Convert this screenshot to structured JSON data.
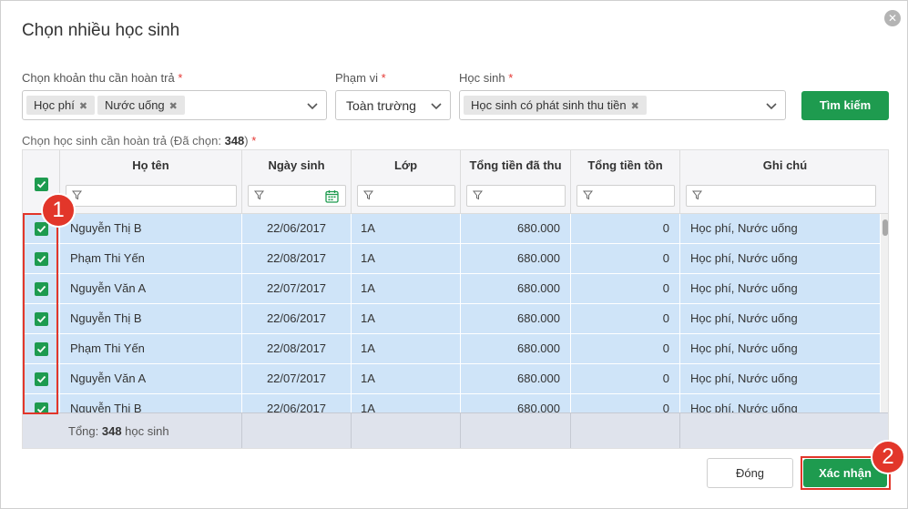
{
  "dialog": {
    "title": "Chọn nhiều học sinh",
    "close_icon": "close-icon"
  },
  "filters": {
    "fee_label": "Chọn khoản thu cần hoàn trả",
    "fee_tags": [
      "Học phí",
      "Nước uống"
    ],
    "scope_label": "Phạm vi",
    "scope_value": "Toàn trường",
    "student_label": "Học sinh",
    "student_tag": "Học sinh có phát sinh thu tiền",
    "required_mark": "*",
    "tag_remove": "✖",
    "search_button": "Tìm kiếm"
  },
  "grid": {
    "label_prefix": "Chọn học sinh cần hoàn trả (Đã chọn: ",
    "selected_count": "348",
    "label_suffix": ")",
    "columns": [
      "Họ tên",
      "Ngày sinh",
      "Lớp",
      "Tổng tiền đã thu",
      "Tổng tiền tồn",
      "Ghi chú"
    ],
    "rows": [
      {
        "name": "Nguyễn Thị B",
        "dob": "22/06/2017",
        "class": "1A",
        "paid": "680.000",
        "balance": "0",
        "note": "Học phí, Nước uống"
      },
      {
        "name": "Phạm Thi Yến",
        "dob": "22/08/2017",
        "class": "1A",
        "paid": "680.000",
        "balance": "0",
        "note": "Học phí, Nước uống"
      },
      {
        "name": "Nguyễn Văn A",
        "dob": "22/07/2017",
        "class": "1A",
        "paid": "680.000",
        "balance": "0",
        "note": "Học phí, Nước uống"
      },
      {
        "name": "Nguyễn Thị B",
        "dob": "22/06/2017",
        "class": "1A",
        "paid": "680.000",
        "balance": "0",
        "note": "Học phí, Nước uống"
      },
      {
        "name": "Phạm Thi Yến",
        "dob": "22/08/2017",
        "class": "1A",
        "paid": "680.000",
        "balance": "0",
        "note": "Học phí, Nước uống"
      },
      {
        "name": "Nguyễn Văn A",
        "dob": "22/07/2017",
        "class": "1A",
        "paid": "680.000",
        "balance": "0",
        "note": "Học phí, Nước uống"
      },
      {
        "name": "Nguyễn Thị B",
        "dob": "22/06/2017",
        "class": "1A",
        "paid": "680.000",
        "balance": "0",
        "note": "Học phí, Nước uống"
      }
    ],
    "footer_prefix": "Tổng: ",
    "footer_count": "348",
    "footer_suffix": " học sinh"
  },
  "actions": {
    "close_label": "Đóng",
    "confirm_label": "Xác nhận"
  },
  "callouts": {
    "one": "1",
    "two": "2"
  },
  "colors": {
    "accent_green": "#1e9b4f",
    "selected_row": "#cfe4f8",
    "callout_red": "#e2362a"
  }
}
